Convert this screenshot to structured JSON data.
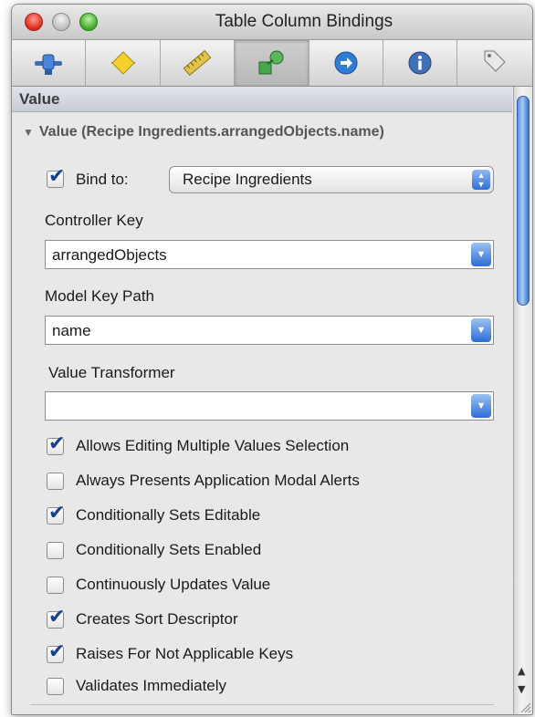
{
  "window": {
    "title": "Table Column Bindings"
  },
  "toolbar": {
    "tabs": [
      {
        "icon": "attributes-icon"
      },
      {
        "icon": "effects-icon"
      },
      {
        "icon": "size-ruler-icon"
      },
      {
        "icon": "connections-icon",
        "active": true
      },
      {
        "icon": "arrow-circle-icon"
      },
      {
        "icon": "info-icon"
      },
      {
        "icon": "identity-tag-icon"
      }
    ]
  },
  "section": {
    "header": "Value",
    "disclosure_label": "Value (Recipe Ingredients.arrangedObjects.name)"
  },
  "bind_to": {
    "label": "Bind to:",
    "checked": true,
    "selected": "Recipe Ingredients"
  },
  "controller_key": {
    "label": "Controller Key",
    "value": "arrangedObjects"
  },
  "model_key_path": {
    "label": "Model Key Path",
    "value": "name"
  },
  "value_transformer": {
    "label": "Value Transformer",
    "value": ""
  },
  "options": [
    {
      "label": "Allows Editing Multiple Values Selection",
      "checked": true
    },
    {
      "label": "Always Presents Application Modal Alerts",
      "checked": false
    },
    {
      "label": "Conditionally Sets Editable",
      "checked": true
    },
    {
      "label": "Conditionally Sets Enabled",
      "checked": false
    },
    {
      "label": "Continuously Updates Value",
      "checked": false
    },
    {
      "label": "Creates Sort Descriptor",
      "checked": true
    },
    {
      "label": "Raises For Not Applicable Keys",
      "checked": true
    },
    {
      "label": "Validates Immediately",
      "checked": false
    }
  ],
  "colors": {
    "accent": "#2f6fd6",
    "check": "#163f8c"
  }
}
